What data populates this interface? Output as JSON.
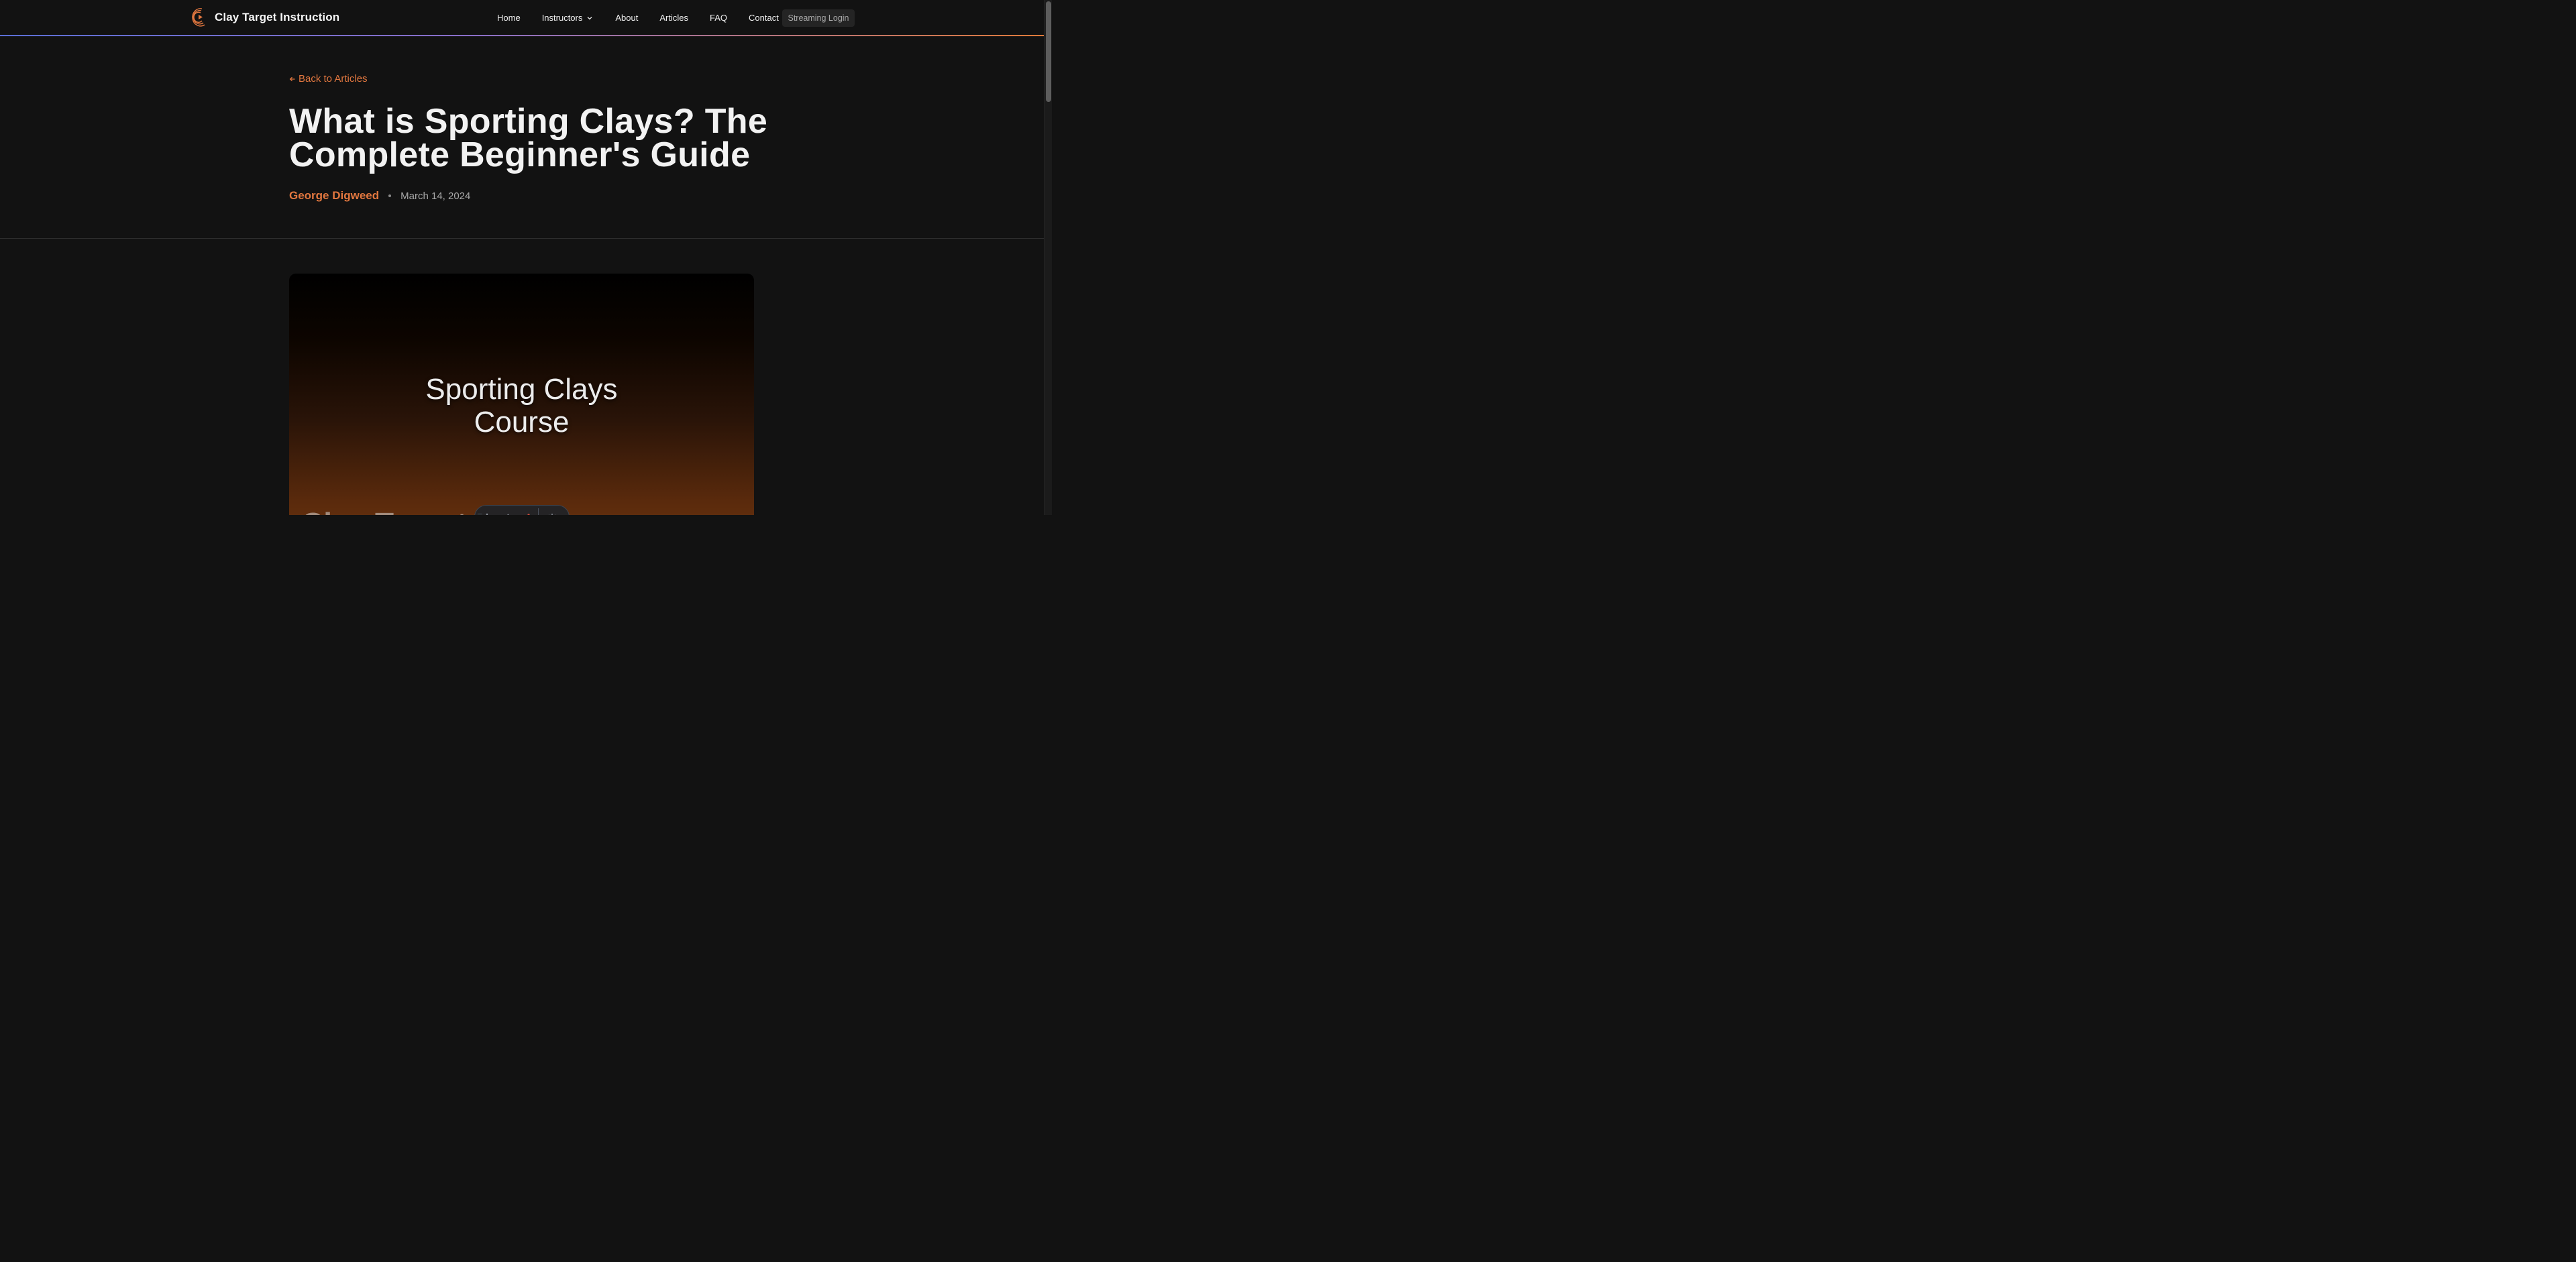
{
  "site": {
    "brand_name": "Clay Target Instruction",
    "accent_color": "#e2773f"
  },
  "nav": {
    "items": [
      {
        "label": "Home"
      },
      {
        "label": "Instructors"
      },
      {
        "label": "About"
      },
      {
        "label": "Articles"
      },
      {
        "label": "FAQ"
      },
      {
        "label": "Contact"
      }
    ],
    "login_label": "Streaming Login"
  },
  "article": {
    "back_label": "Back to Articles",
    "title": "What is Sporting Clays? The Complete Beginner's Guide",
    "author": "George Digweed",
    "date": "March 14, 2024"
  },
  "hero": {
    "title_line1": "Sporting Clays",
    "title_line2": "Course",
    "bottom_text": "Clay Target I"
  },
  "icons": [
    "logo-icon",
    "chevron-down-icon",
    "arrow-left-icon",
    "text-icon",
    "pen-icon",
    "list-icon",
    "gear-icon"
  ]
}
